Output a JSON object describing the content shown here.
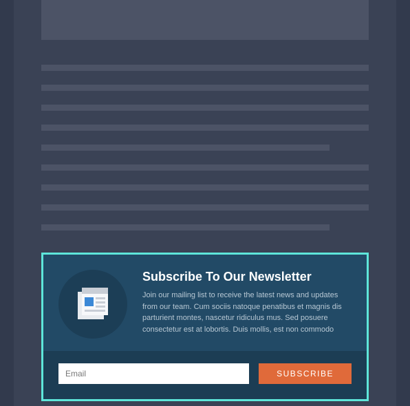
{
  "newsletter": {
    "title": "Subscribe To Our Newsletter",
    "body": "Join our mailing list to receive the latest news and updates from our team. Cum sociis natoque penatibus et magnis dis parturient montes, nascetur ridiculus mus. Sed posuere consectetur est at lobortis. Duis mollis, est non commodo",
    "email_placeholder": "Email",
    "subscribe_label": "SUBSCRIBE"
  }
}
